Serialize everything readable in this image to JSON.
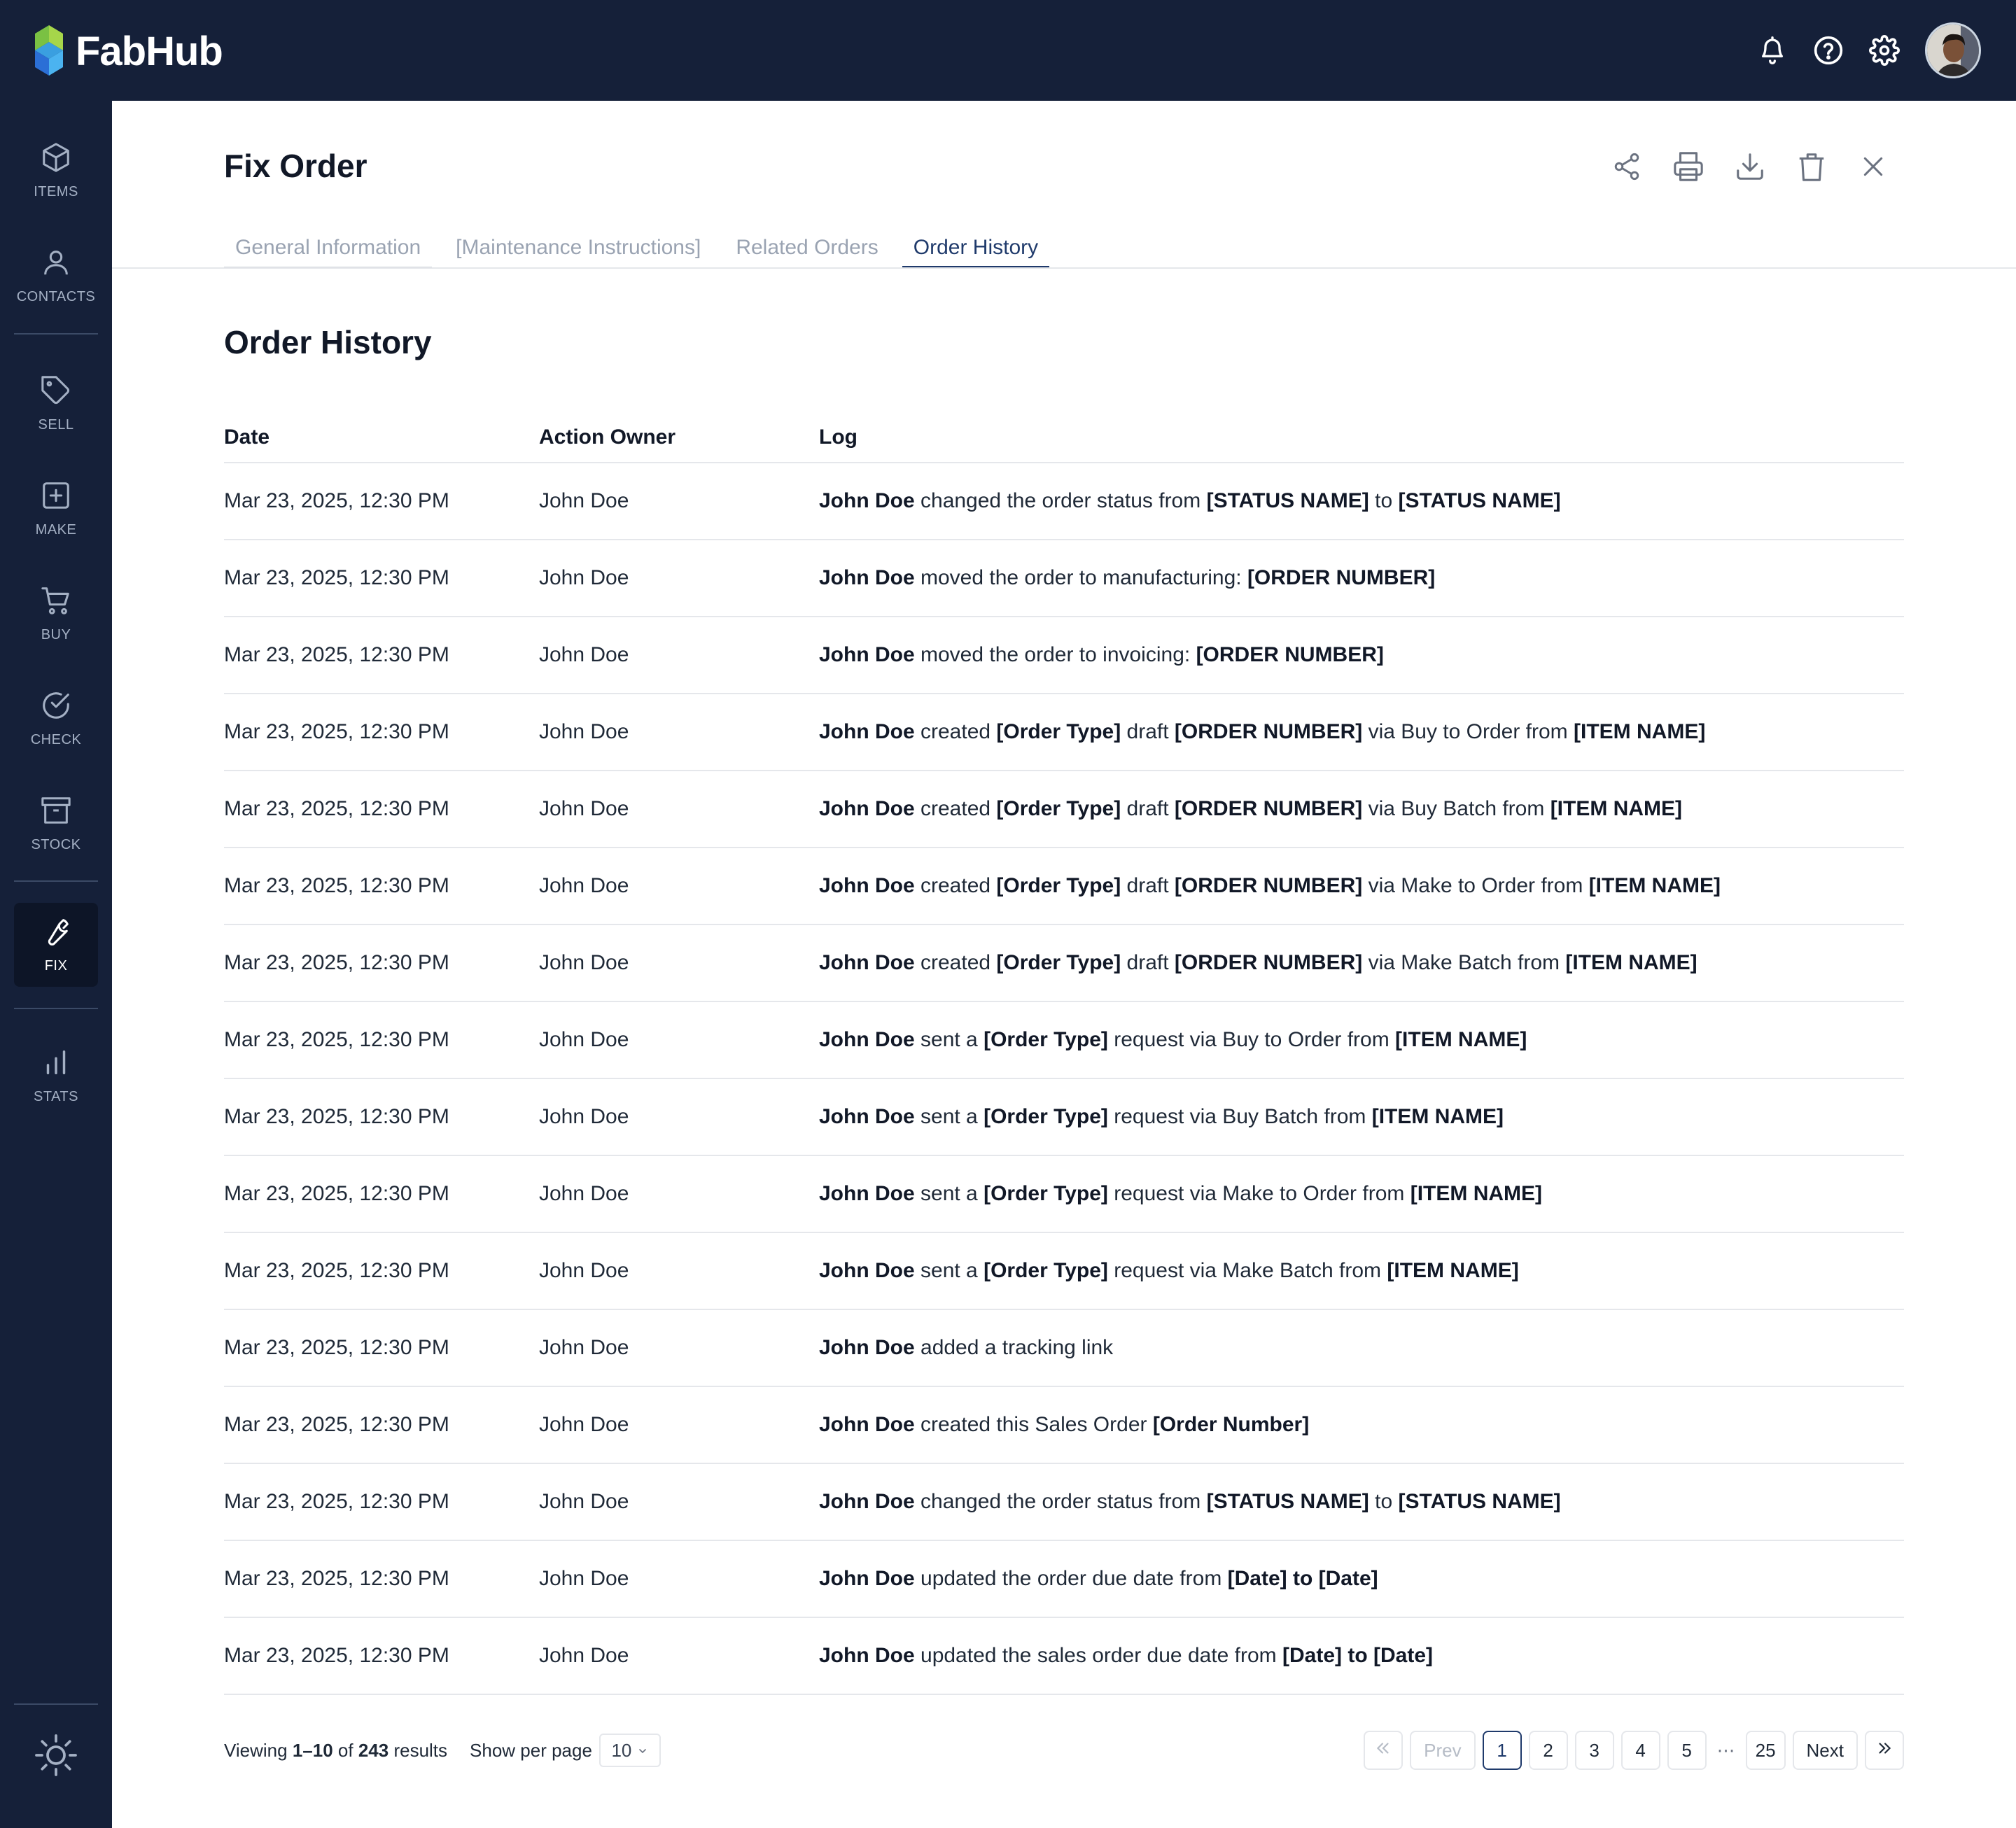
{
  "app": {
    "name": "FabHub"
  },
  "topbar": {
    "icons": [
      "bell-icon",
      "help-circle-icon",
      "gear-icon"
    ],
    "avatar_alt": "user avatar"
  },
  "sidebar": {
    "items": [
      {
        "label": "ITEMS",
        "icon": "box-icon"
      },
      {
        "label": "CONTACTS",
        "icon": "person-icon"
      },
      {
        "label": "SELL",
        "icon": "tag-icon"
      },
      {
        "label": "MAKE",
        "icon": "plus-square-icon"
      },
      {
        "label": "BUY",
        "icon": "cart-icon"
      },
      {
        "label": "CHECK",
        "icon": "check-circle-icon"
      },
      {
        "label": "STOCK",
        "icon": "archive-icon"
      },
      {
        "label": "FIX",
        "icon": "wrench-icon",
        "active": true
      },
      {
        "label": "STATS",
        "icon": "bar-chart-icon"
      }
    ],
    "bottom_icon": "sun-icon"
  },
  "page": {
    "title": "Fix Order",
    "actions": [
      "share-icon",
      "print-icon",
      "download-icon",
      "trash-icon",
      "close-icon"
    ],
    "tabs": [
      {
        "label": "General Information"
      },
      {
        "label": "[Maintenance Instructions]"
      },
      {
        "label": "Related Orders"
      },
      {
        "label": "Order History",
        "active": true
      }
    ]
  },
  "history": {
    "title": "Order History",
    "columns": {
      "date": "Date",
      "owner": "Action Owner",
      "log": "Log"
    },
    "rows": [
      {
        "date": "Mar 23, 2025, 12:30 PM",
        "owner": "John Doe",
        "log": [
          [
            "b",
            "John Doe"
          ],
          [
            "t",
            " changed the order status from "
          ],
          [
            "b",
            "[STATUS NAME]"
          ],
          [
            "t",
            " to "
          ],
          [
            "b",
            "[STATUS NAME]"
          ]
        ]
      },
      {
        "date": "Mar 23, 2025, 12:30 PM",
        "owner": "John Doe",
        "log": [
          [
            "b",
            "John Doe"
          ],
          [
            "t",
            " moved the order to manufacturing: "
          ],
          [
            "b",
            "[ORDER NUMBER]"
          ]
        ]
      },
      {
        "date": "Mar 23, 2025, 12:30 PM",
        "owner": "John Doe",
        "log": [
          [
            "b",
            "John Doe"
          ],
          [
            "t",
            " moved the order to invoicing: "
          ],
          [
            "b",
            "[ORDER NUMBER]"
          ]
        ]
      },
      {
        "date": "Mar 23, 2025, 12:30 PM",
        "owner": "John Doe",
        "log": [
          [
            "b",
            "John Doe"
          ],
          [
            "t",
            " created "
          ],
          [
            "b",
            "[Order Type]"
          ],
          [
            "t",
            " draft "
          ],
          [
            "b",
            "[ORDER NUMBER]"
          ],
          [
            "t",
            " via Buy to Order from "
          ],
          [
            "b",
            "[ITEM NAME]"
          ]
        ]
      },
      {
        "date": "Mar 23, 2025, 12:30 PM",
        "owner": "John Doe",
        "log": [
          [
            "b",
            "John Doe"
          ],
          [
            "t",
            " created "
          ],
          [
            "b",
            "[Order Type]"
          ],
          [
            "t",
            " draft "
          ],
          [
            "b",
            "[ORDER NUMBER]"
          ],
          [
            "t",
            " via Buy Batch from "
          ],
          [
            "b",
            "[ITEM NAME]"
          ]
        ]
      },
      {
        "date": "Mar 23, 2025, 12:30 PM",
        "owner": "John Doe",
        "log": [
          [
            "b",
            "John Doe"
          ],
          [
            "t",
            " created "
          ],
          [
            "b",
            "[Order Type]"
          ],
          [
            "t",
            " draft "
          ],
          [
            "b",
            "[ORDER NUMBER]"
          ],
          [
            "t",
            " via Make to Order from "
          ],
          [
            "b",
            "[ITEM NAME]"
          ]
        ]
      },
      {
        "date": "Mar 23, 2025, 12:30 PM",
        "owner": "John Doe",
        "log": [
          [
            "b",
            "John Doe"
          ],
          [
            "t",
            " created "
          ],
          [
            "b",
            "[Order Type]"
          ],
          [
            "t",
            " draft "
          ],
          [
            "b",
            "[ORDER NUMBER]"
          ],
          [
            "t",
            " via Make Batch from "
          ],
          [
            "b",
            "[ITEM NAME]"
          ]
        ]
      },
      {
        "date": "Mar 23, 2025, 12:30 PM",
        "owner": "John Doe",
        "log": [
          [
            "b",
            "John Doe"
          ],
          [
            "t",
            " sent a "
          ],
          [
            "b",
            "[Order Type]"
          ],
          [
            "t",
            " request via Buy to Order from "
          ],
          [
            "b",
            "[ITEM NAME]"
          ]
        ]
      },
      {
        "date": "Mar 23, 2025, 12:30 PM",
        "owner": "John Doe",
        "log": [
          [
            "b",
            "John Doe"
          ],
          [
            "t",
            " sent a "
          ],
          [
            "b",
            "[Order Type]"
          ],
          [
            "t",
            " request via Buy Batch from "
          ],
          [
            "b",
            "[ITEM NAME]"
          ]
        ]
      },
      {
        "date": "Mar 23, 2025, 12:30 PM",
        "owner": "John Doe",
        "log": [
          [
            "b",
            "John Doe"
          ],
          [
            "t",
            " sent a "
          ],
          [
            "b",
            "[Order Type]"
          ],
          [
            "t",
            " request via Make to Order from "
          ],
          [
            "b",
            "[ITEM NAME]"
          ]
        ]
      },
      {
        "date": "Mar 23, 2025, 12:30 PM",
        "owner": "John Doe",
        "log": [
          [
            "b",
            "John Doe"
          ],
          [
            "t",
            " sent a "
          ],
          [
            "b",
            "[Order Type]"
          ],
          [
            "t",
            " request via Make Batch from "
          ],
          [
            "b",
            "[ITEM NAME]"
          ]
        ]
      },
      {
        "date": "Mar 23, 2025, 12:30 PM",
        "owner": "John Doe",
        "log": [
          [
            "b",
            "John Doe"
          ],
          [
            "t",
            " added a tracking link"
          ]
        ]
      },
      {
        "date": "Mar 23, 2025, 12:30 PM",
        "owner": "John Doe",
        "log": [
          [
            "b",
            "John Doe"
          ],
          [
            "t",
            " created this Sales Order "
          ],
          [
            "b",
            "[Order Number]"
          ]
        ]
      },
      {
        "date": "Mar 23, 2025, 12:30 PM",
        "owner": "John Doe",
        "log": [
          [
            "b",
            "John Doe"
          ],
          [
            "t",
            " changed the order status from "
          ],
          [
            "b",
            "[STATUS NAME]"
          ],
          [
            "t",
            " to "
          ],
          [
            "b",
            "[STATUS NAME]"
          ]
        ]
      },
      {
        "date": "Mar 23, 2025, 12:30 PM",
        "owner": "John Doe",
        "log": [
          [
            "b",
            "John Doe"
          ],
          [
            "t",
            " updated the order due date from "
          ],
          [
            "b",
            "[Date] to [Date]"
          ]
        ]
      },
      {
        "date": "Mar 23, 2025, 12:30 PM",
        "owner": "John Doe",
        "log": [
          [
            "b",
            "John Doe"
          ],
          [
            "t",
            " updated the sales order due date from "
          ],
          [
            "b",
            "[Date] to [Date]"
          ]
        ]
      }
    ]
  },
  "pagination": {
    "viewing_prefix": "Viewing",
    "range": "1–10",
    "of": "of",
    "total": "243",
    "results_suffix": "results",
    "per_page_label": "Show per page",
    "per_page_value": "10",
    "prev": "Prev",
    "next": "Next",
    "pages": [
      "1",
      "2",
      "3",
      "4",
      "5"
    ],
    "ellipsis": "⋯",
    "last_page": "25",
    "current": "1"
  },
  "colors": {
    "nav_bg": "#152039",
    "accent": "#1f3a6b"
  }
}
